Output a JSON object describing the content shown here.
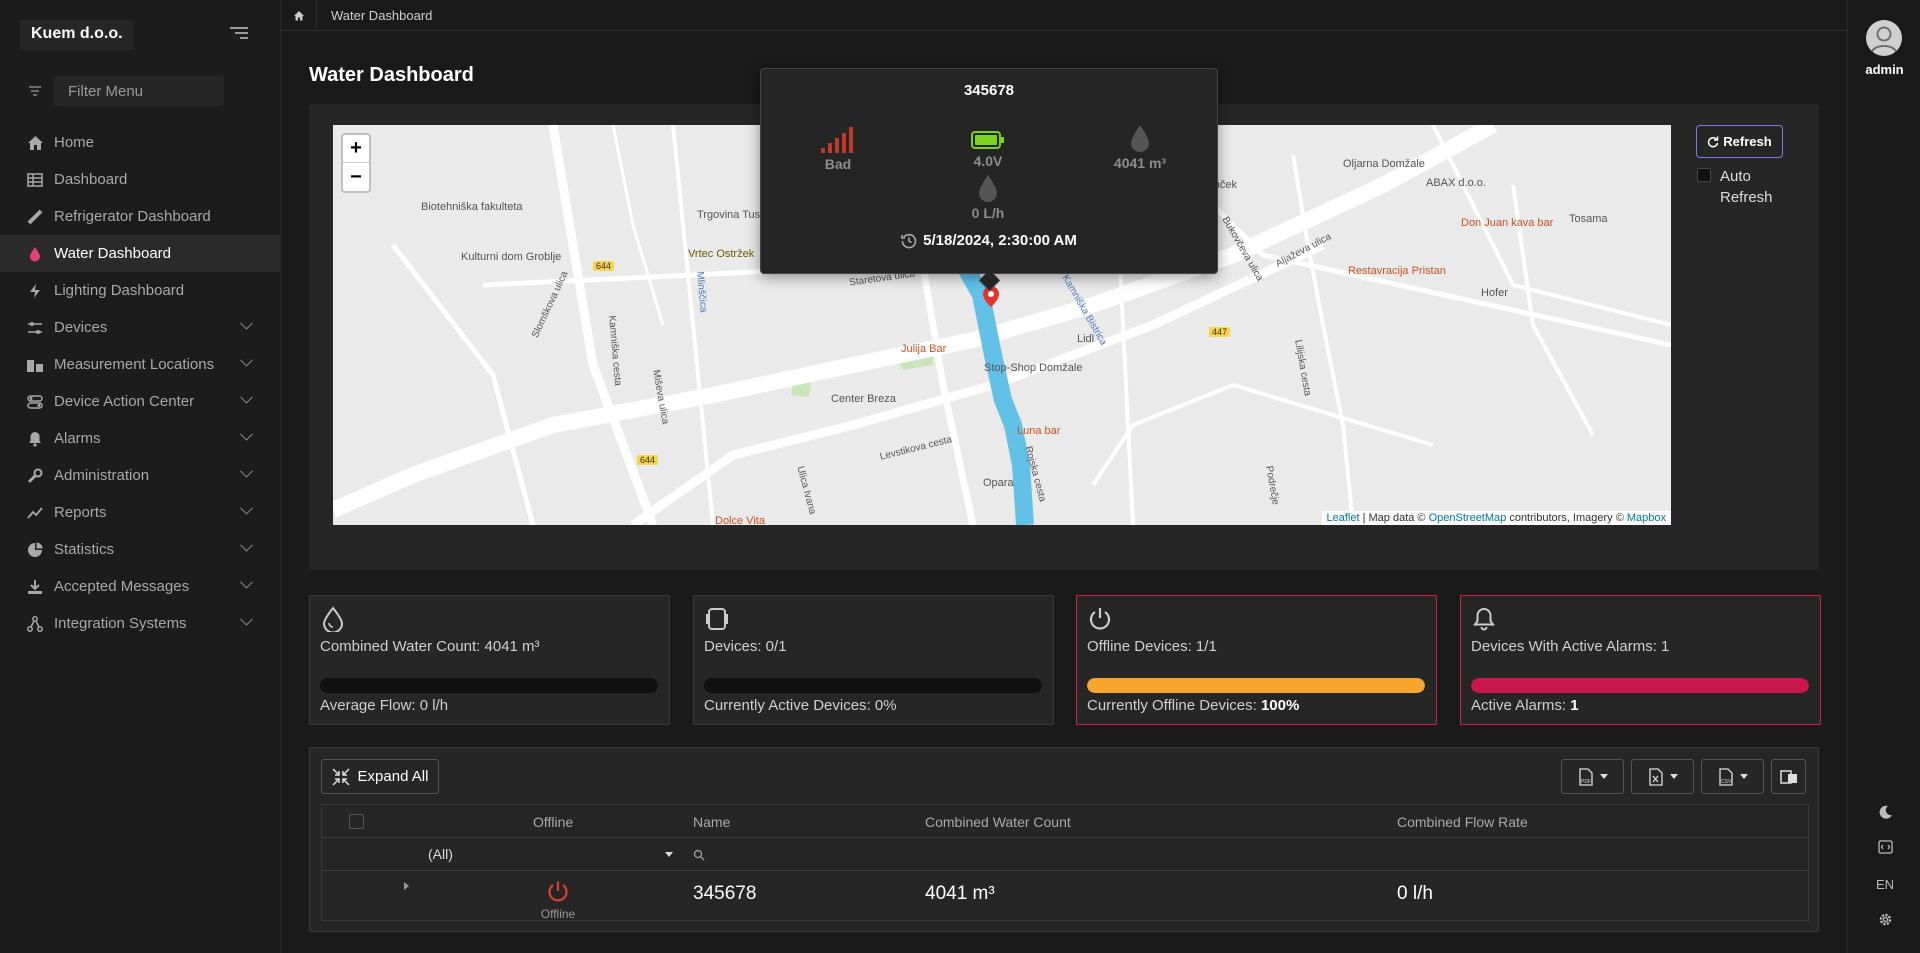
{
  "app": {
    "brand": "Kuem d.o.o."
  },
  "sidebar": {
    "filter_placeholder": "Filter Menu",
    "items": [
      {
        "label": "Home",
        "icon": "home-icon"
      },
      {
        "label": "Dashboard",
        "icon": "table-icon"
      },
      {
        "label": "Refrigerator Dashboard",
        "icon": "ruler-icon"
      },
      {
        "label": "Water Dashboard",
        "icon": "water-drop-icon",
        "active": true
      },
      {
        "label": "Lighting Dashboard",
        "icon": "bolt-icon"
      },
      {
        "label": "Devices",
        "icon": "sliders-icon",
        "expandable": true
      },
      {
        "label": "Measurement Locations",
        "icon": "buildings-icon",
        "expandable": true
      },
      {
        "label": "Device Action Center",
        "icon": "switches-icon",
        "expandable": true
      },
      {
        "label": "Alarms",
        "icon": "bell-icon",
        "expandable": true
      },
      {
        "label": "Administration",
        "icon": "wrench-icon",
        "expandable": true
      },
      {
        "label": "Reports",
        "icon": "chart-icon",
        "expandable": true
      },
      {
        "label": "Statistics",
        "icon": "pie-icon",
        "expandable": true
      },
      {
        "label": "Accepted Messages",
        "icon": "download-icon",
        "expandable": true
      },
      {
        "label": "Integration Systems",
        "icon": "network-icon",
        "expandable": true
      }
    ]
  },
  "breadcrumb": {
    "current": "Water Dashboard"
  },
  "user": {
    "name": "admin"
  },
  "rail": {
    "language": "EN"
  },
  "page": {
    "title": "Water Dashboard"
  },
  "map": {
    "refresh_label": "Refresh",
    "auto_refresh_label": "Auto Refresh",
    "attribution": {
      "leaflet": "Leaflet",
      "sep1": " | Map data © ",
      "osm": "OpenStreetMap",
      "sep2": " contributors, Imagery © ",
      "mapbox": "Mapbox"
    },
    "labels": [
      "Biotehniška fakulteta",
      "Kulturni dom Groblje",
      "Trgovina Tus",
      "Vrtec Ostržek",
      "Mlinščica",
      "Staretova ulica",
      "Kamniška cesta",
      "Slomškova ulica",
      "Miševa ulica",
      "Julija Bar",
      "Center Breza",
      "Stop-Shop Domžale",
      "Lidl",
      "Luna bar",
      "Levstikova cesta",
      "Ulica Ivana",
      "Opara",
      "Rojska cesta",
      "Dolce Vita",
      "Kamniška Bistrica",
      "Podrečje",
      "Lilijska cesta",
      "Bukovčeva ulica",
      "Aljaževa ulica",
      "na Sonček",
      "Oljarna Domžale",
      "ABAX d.o.o.",
      "Don Juan kava bar",
      "Tosama",
      "Restavracija Pristan",
      "Hofer",
      "644",
      "447"
    ],
    "popup": {
      "device_id": "345678",
      "signal": "Bad",
      "battery": "4.0V",
      "water_count": "4041 m³",
      "flow": "0 L/h",
      "timestamp": "5/18/2024, 2:30:00 AM"
    }
  },
  "cards": [
    {
      "title": "Combined Water Count: 4041 m³",
      "sub_label": "Average Flow: 0 l/h",
      "sub_value": "",
      "fill": 0,
      "color": "#111111",
      "icon": "water-drop-icon"
    },
    {
      "title": "Devices: 0/1",
      "sub_label": "Currently Active Devices: 0%",
      "sub_value": "",
      "fill": 0,
      "color": "#111111",
      "icon": "device-icon"
    },
    {
      "title": "Offline Devices: 1/1",
      "sub_label": "Currently Offline Devices: ",
      "sub_value": "100%",
      "fill": 1,
      "color": "#f6a52e",
      "icon": "power-icon"
    },
    {
      "title": "Devices With Active Alarms: 1",
      "sub_label": "Active Alarms: ",
      "sub_value": "1",
      "fill": 1,
      "color": "#c8174a",
      "icon": "bell-icon"
    }
  ],
  "grid": {
    "expand_label": "Expand All",
    "export_pdf": "PDF",
    "export_xls": "XLS",
    "export_csv": "CSV",
    "columns": [
      "Offline",
      "Name",
      "Combined Water Count",
      "Combined Flow Rate"
    ],
    "filter_select": "(All)",
    "rows": [
      {
        "status": "Offline",
        "name": "345678",
        "water_count": "4041 m³",
        "flow_rate": "0 l/h"
      }
    ]
  },
  "colors": {
    "accent": "#7b77e8",
    "active_nav_icon": "#e0407a",
    "offline": "#e03e2d",
    "warning": "#f6a52e",
    "alarm": "#c8174a"
  }
}
